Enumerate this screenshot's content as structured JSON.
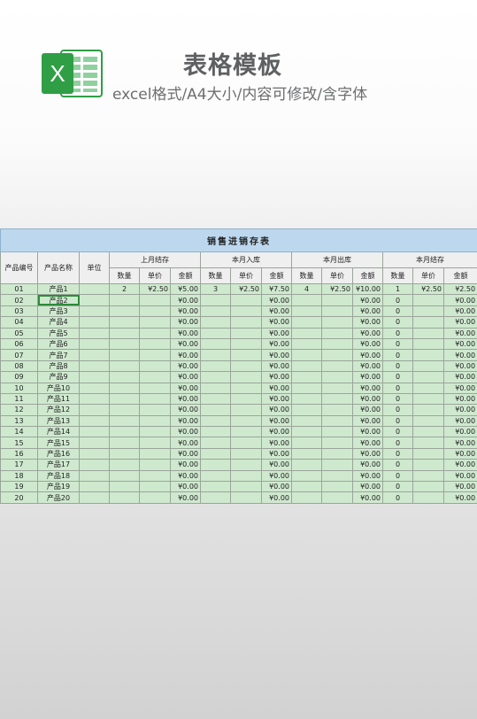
{
  "header": {
    "title": "表格模板",
    "subtitle": "excel格式/A4大小/内容可修改/含字体",
    "logo_icon": "excel-logo-icon",
    "logo_letter": "X",
    "colors": {
      "logo_green": "#2f9e44",
      "logo_light": "#8fd19e"
    }
  },
  "table": {
    "title": "销售进销存表",
    "col_no": "产品编号",
    "col_name": "产品名称",
    "col_unit": "单位",
    "groups": [
      "上月结存",
      "本月入库",
      "本月出库",
      "本月结存"
    ],
    "sub_headers": [
      "数量",
      "单价",
      "金额"
    ],
    "rows": [
      [
        "01",
        "产品1",
        "",
        "2",
        "¥2.50",
        "¥5.00",
        "3",
        "¥2.50",
        "¥7.50",
        "4",
        "¥2.50",
        "¥10.00",
        "1",
        "¥2.50",
        "¥2.50"
      ],
      [
        "02",
        "产品2",
        "",
        "",
        "",
        "¥0.00",
        "",
        "",
        "¥0.00",
        "",
        "",
        "¥0.00",
        "0",
        "",
        "¥0.00"
      ],
      [
        "03",
        "产品3",
        "",
        "",
        "",
        "¥0.00",
        "",
        "",
        "¥0.00",
        "",
        "",
        "¥0.00",
        "0",
        "",
        "¥0.00"
      ],
      [
        "04",
        "产品4",
        "",
        "",
        "",
        "¥0.00",
        "",
        "",
        "¥0.00",
        "",
        "",
        "¥0.00",
        "0",
        "",
        "¥0.00"
      ],
      [
        "05",
        "产品5",
        "",
        "",
        "",
        "¥0.00",
        "",
        "",
        "¥0.00",
        "",
        "",
        "¥0.00",
        "0",
        "",
        "¥0.00"
      ],
      [
        "06",
        "产品6",
        "",
        "",
        "",
        "¥0.00",
        "",
        "",
        "¥0.00",
        "",
        "",
        "¥0.00",
        "0",
        "",
        "¥0.00"
      ],
      [
        "07",
        "产品7",
        "",
        "",
        "",
        "¥0.00",
        "",
        "",
        "¥0.00",
        "",
        "",
        "¥0.00",
        "0",
        "",
        "¥0.00"
      ],
      [
        "08",
        "产品8",
        "",
        "",
        "",
        "¥0.00",
        "",
        "",
        "¥0.00",
        "",
        "",
        "¥0.00",
        "0",
        "",
        "¥0.00"
      ],
      [
        "09",
        "产品9",
        "",
        "",
        "",
        "¥0.00",
        "",
        "",
        "¥0.00",
        "",
        "",
        "¥0.00",
        "0",
        "",
        "¥0.00"
      ],
      [
        "10",
        "产品10",
        "",
        "",
        "",
        "¥0.00",
        "",
        "",
        "¥0.00",
        "",
        "",
        "¥0.00",
        "0",
        "",
        "¥0.00"
      ],
      [
        "11",
        "产品11",
        "",
        "",
        "",
        "¥0.00",
        "",
        "",
        "¥0.00",
        "",
        "",
        "¥0.00",
        "0",
        "",
        "¥0.00"
      ],
      [
        "12",
        "产品12",
        "",
        "",
        "",
        "¥0.00",
        "",
        "",
        "¥0.00",
        "",
        "",
        "¥0.00",
        "0",
        "",
        "¥0.00"
      ],
      [
        "13",
        "产品13",
        "",
        "",
        "",
        "¥0.00",
        "",
        "",
        "¥0.00",
        "",
        "",
        "¥0.00",
        "0",
        "",
        "¥0.00"
      ],
      [
        "14",
        "产品14",
        "",
        "",
        "",
        "¥0.00",
        "",
        "",
        "¥0.00",
        "",
        "",
        "¥0.00",
        "0",
        "",
        "¥0.00"
      ],
      [
        "15",
        "产品15",
        "",
        "",
        "",
        "¥0.00",
        "",
        "",
        "¥0.00",
        "",
        "",
        "¥0.00",
        "0",
        "",
        "¥0.00"
      ],
      [
        "16",
        "产品16",
        "",
        "",
        "",
        "¥0.00",
        "",
        "",
        "¥0.00",
        "",
        "",
        "¥0.00",
        "0",
        "",
        "¥0.00"
      ],
      [
        "17",
        "产品17",
        "",
        "",
        "",
        "¥0.00",
        "",
        "",
        "¥0.00",
        "",
        "",
        "¥0.00",
        "0",
        "",
        "¥0.00"
      ],
      [
        "18",
        "产品18",
        "",
        "",
        "",
        "¥0.00",
        "",
        "",
        "¥0.00",
        "",
        "",
        "¥0.00",
        "0",
        "",
        "¥0.00"
      ],
      [
        "19",
        "产品19",
        "",
        "",
        "",
        "¥0.00",
        "",
        "",
        "¥0.00",
        "",
        "",
        "¥0.00",
        "0",
        "",
        "¥0.00"
      ],
      [
        "20",
        "产品20",
        "",
        "",
        "",
        "¥0.00",
        "",
        "",
        "¥0.00",
        "",
        "",
        "¥0.00",
        "0",
        "",
        "¥0.00"
      ]
    ],
    "selected_row": 1
  }
}
